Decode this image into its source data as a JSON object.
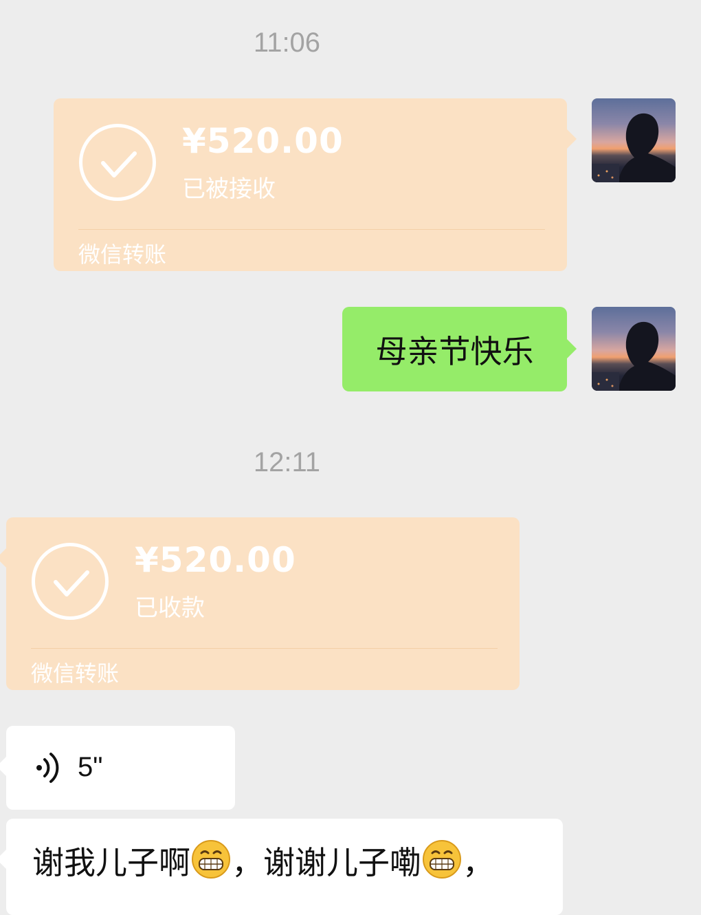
{
  "messages": {
    "time_1": "11:06",
    "transfer_sent": {
      "amount": "¥520.00",
      "status": "已被接收",
      "label": "微信转账"
    },
    "greeting_text": "母亲节快乐",
    "time_2": "12:11",
    "transfer_received": {
      "amount": "¥520.00",
      "status": "已收款",
      "label": "微信转账"
    },
    "voice": {
      "duration": "5\""
    },
    "reply": {
      "line_1": [
        "谢我儿子啊",
        "，谢谢儿子嘞",
        "，"
      ],
      "emoji": "grinning-face-emoji"
    }
  },
  "colors": {
    "background": "#ededed",
    "transfer_bubble": "#fbe1c4",
    "sent_bubble": "#95ec69",
    "received_bubble": "#ffffff",
    "timestamp": "#a3a3a3"
  }
}
